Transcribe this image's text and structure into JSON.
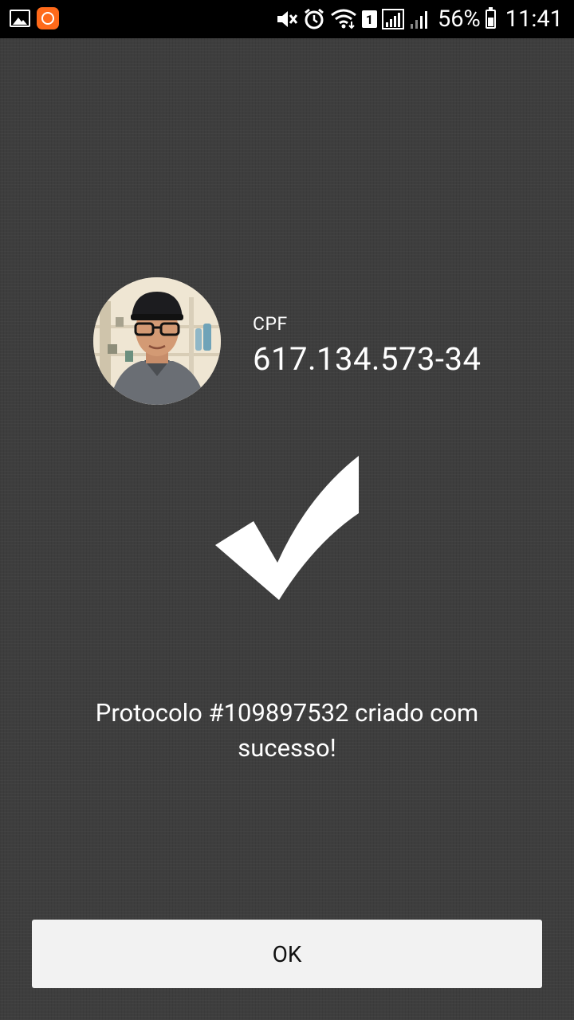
{
  "status_bar": {
    "battery_percent": "56%",
    "time": "11:41",
    "sim_slot": "1",
    "icons": [
      "gallery-icon",
      "app-notification-icon",
      "mute-icon",
      "alarm-icon",
      "wifi-icon",
      "signal-icon",
      "battery-icon"
    ]
  },
  "profile": {
    "cpf_label": "CPF",
    "cpf_value": "617.134.573-34"
  },
  "result": {
    "message": "Protocolo #109897532 criado com sucesso!",
    "icon": "checkmark-icon"
  },
  "actions": {
    "ok_label": "OK"
  },
  "colors": {
    "background": "#3e3e3e",
    "status_bar": "#000000",
    "button_bg": "#f2f2f2",
    "app_icon": "#ff6a1a"
  }
}
